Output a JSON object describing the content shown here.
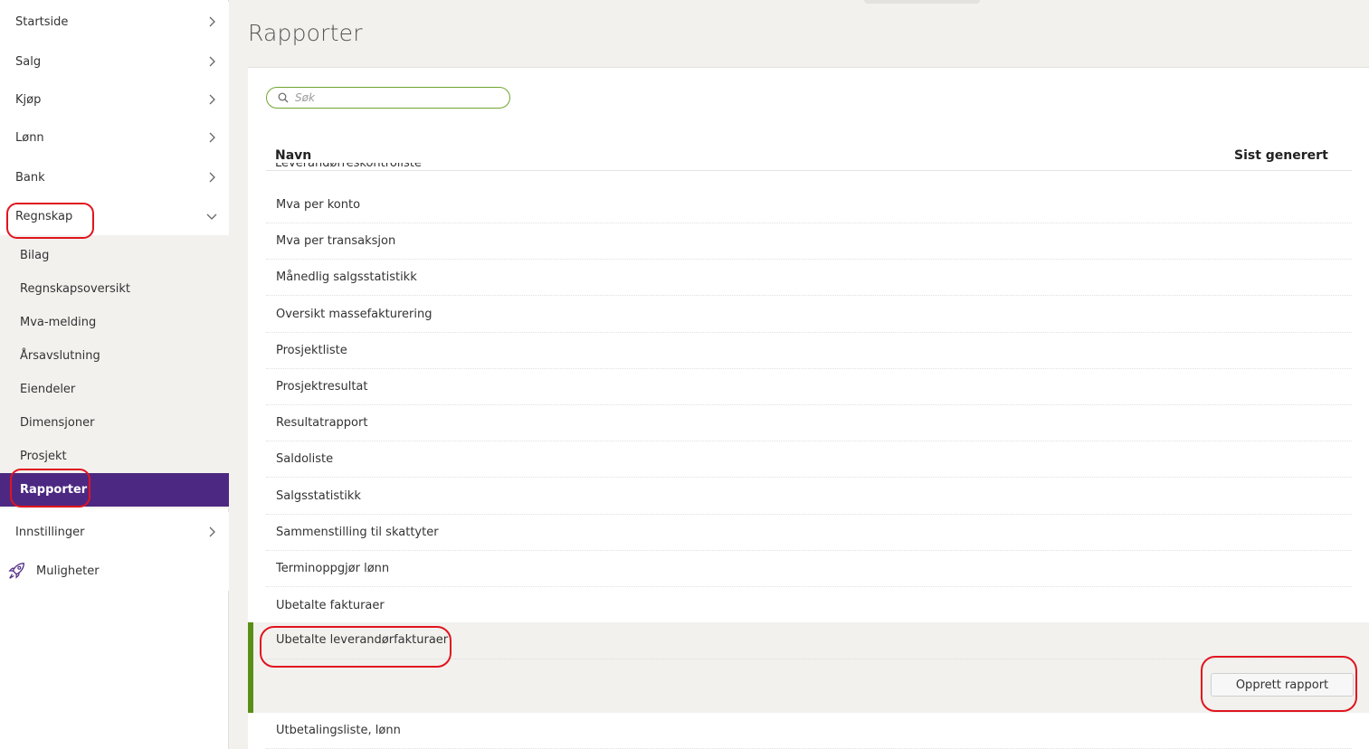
{
  "sidebar": {
    "items": [
      {
        "label": "Startside"
      },
      {
        "label": "Salg"
      },
      {
        "label": "Kjøp"
      },
      {
        "label": "Lønn"
      },
      {
        "label": "Bank"
      },
      {
        "label": "Regnskap"
      }
    ],
    "sub_items": [
      {
        "label": "Bilag"
      },
      {
        "label": "Regnskapsoversikt"
      },
      {
        "label": "Mva-melding"
      },
      {
        "label": "Årsavslutning"
      },
      {
        "label": "Eiendeler"
      },
      {
        "label": "Dimensjoner"
      },
      {
        "label": "Prosjekt"
      },
      {
        "label": "Rapporter"
      }
    ],
    "settings": {
      "label": "Innstillinger"
    },
    "opportunities": {
      "label": "Muligheter"
    }
  },
  "page": {
    "title": "Rapporter"
  },
  "search": {
    "placeholder": "Søk"
  },
  "table": {
    "col_name": "Navn",
    "col_generated": "Sist generert",
    "clipped_row": "Leverandørreskontroliste",
    "rows": [
      "Mva per konto",
      "Mva per transaksjon",
      "Månedlig salgsstatistikk",
      "Oversikt massefakturering",
      "Prosjektliste",
      "Prosjektresultat",
      "Resultatrapport",
      "Saldoliste",
      "Salgsstatistikk",
      "Sammenstilling til skattyter",
      "Terminoppgjør lønn",
      "Ubetalte fakturaer"
    ],
    "selected_row": "Ubetalte leverandørfakturaer",
    "create_button": "Opprett rapport",
    "last_row": "Utbetalingsliste, lønn"
  },
  "colors": {
    "accent_purple": "#4c2882",
    "accent_green": "#5a8f17",
    "annotation_red": "#e1141e"
  },
  "icons": {
    "nav_chevron": "chevron-right-icon",
    "nav_expanded": "chevron-down-icon",
    "search": "search-icon",
    "opportunities": "rocket-icon"
  }
}
